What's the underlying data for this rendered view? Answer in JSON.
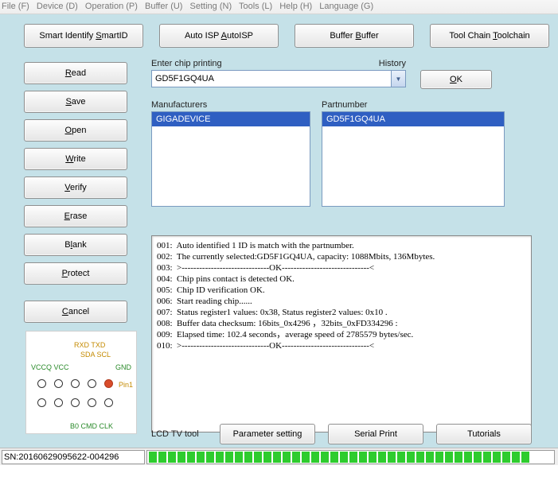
{
  "menu": {
    "file": "File (F)",
    "device": "Device (D)",
    "operation": "Operation (P)",
    "buffer": "Buffer (U)",
    "setting": "Setting (N)",
    "tools": "Tools (L)",
    "help": "Help (H)",
    "language": "Language (G)"
  },
  "topButtons": {
    "smartId": "Smart Identify SmartID",
    "autoIsp": "Auto ISP AutoISP",
    "buffer": "Buffer Buffer",
    "toolchain": "Tool Chain Toolchain"
  },
  "sideButtons": {
    "read": "Read",
    "save": "Save",
    "open": "Open",
    "write": "Write",
    "verify": "Verify",
    "erase": "Erase",
    "blank": "Blank",
    "protect": "Protect",
    "cancel": "Cancel"
  },
  "chipPanel": {
    "rx": "RXD TXD",
    "sda": "SDA SCL",
    "vccq": "VCCQ  VCC",
    "gnd": "GND",
    "pin1": "Pin1",
    "b0": "B0   CMD  CLK"
  },
  "labels": {
    "enterChip": "Enter chip printing",
    "history": "History",
    "ok": "OK",
    "manufacturers": "Manufacturers",
    "partnumber": "Partnumber",
    "lcd": "LCD TV tool",
    "param": "Parameter setting",
    "serial": "Serial Print",
    "tutorials": "Tutorials",
    "sn": "SN:20160629095622-004296"
  },
  "chipInput": "GD5F1GQ4UA",
  "manufacturer": "GIGADEVICE",
  "part": "GD5F1GQ4UA",
  "logLines": [
    "001:  Auto identified 1 ID is match with the partnumber.",
    "002:  The currently selected:GD5F1GQ4UA, capacity: 1088Mbits, 136Mbytes.",
    "003:  >------------------------------OK------------------------------<",
    "004:  Chip pins contact is detected OK.",
    "005:  Chip ID verification OK.",
    "006:  Start reading chip......",
    "007:  Status register1 values: 0x38, Status register2 values: 0x10 .",
    "008:  Buffer data checksum: 16bits_0x4296 ，32bits_0xFD334296 :",
    "009:  Elapsed time: 102.4 seconds，average speed of 2785579 bytes/sec.",
    "010:  >------------------------------OK------------------------------<"
  ]
}
